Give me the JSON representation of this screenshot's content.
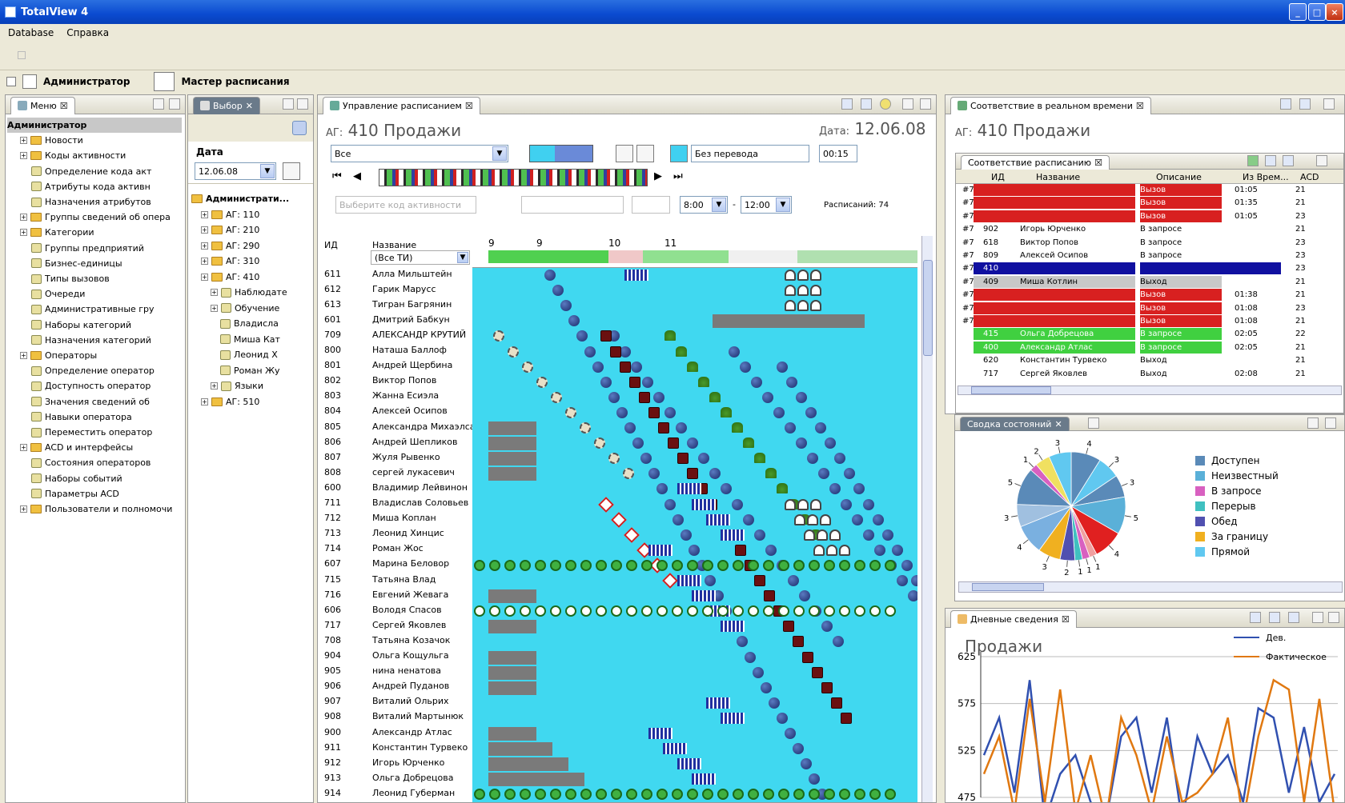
{
  "window": {
    "title": "TotalView 4",
    "btn_min": "_",
    "btn_max": "□",
    "btn_close": "×"
  },
  "menu": [
    "Database",
    "Справка"
  ],
  "perspectives": [
    "Администратор",
    "Мастер расписания"
  ],
  "menu_view": {
    "tab": "Меню",
    "items": [
      {
        "label": "Администратор",
        "level": 0,
        "selected": true
      },
      {
        "label": "Новости",
        "level": 1
      },
      {
        "label": "Коды активности",
        "level": 1
      },
      {
        "label": "Определение кода акт",
        "level": 2
      },
      {
        "label": "Атрибуты кода активн",
        "level": 2
      },
      {
        "label": "Назначения атрибутов",
        "level": 2
      },
      {
        "label": "Группы сведений об опера",
        "level": 1
      },
      {
        "label": "Категории",
        "level": 1
      },
      {
        "label": "Группы предприятий",
        "level": 2
      },
      {
        "label": "Бизнес-единицы",
        "level": 2
      },
      {
        "label": "Типы вызовов",
        "level": 2
      },
      {
        "label": "Очереди",
        "level": 2
      },
      {
        "label": "Административные гру",
        "level": 2
      },
      {
        "label": "Наборы категорий",
        "level": 2
      },
      {
        "label": "Назначения категорий",
        "level": 2
      },
      {
        "label": "Операторы",
        "level": 1
      },
      {
        "label": "Определение оператор",
        "level": 2
      },
      {
        "label": "Доступность оператор",
        "level": 2
      },
      {
        "label": "Значения сведений об",
        "level": 2
      },
      {
        "label": "Навыки оператора",
        "level": 2
      },
      {
        "label": "Переместить оператор",
        "level": 2
      },
      {
        "label": "ACD и интерфейсы",
        "level": 1
      },
      {
        "label": "Состояния операторов",
        "level": 2
      },
      {
        "label": "Наборы событий",
        "level": 2
      },
      {
        "label": "Параметры ACD",
        "level": 2
      },
      {
        "label": "Пользователи и полномочи",
        "level": 1
      }
    ]
  },
  "select_view": {
    "tab": "Выбор",
    "date_label": "Дата",
    "date_value": "12.06.08",
    "tree": [
      {
        "label": "Администрати...",
        "level": 0
      },
      {
        "label": "АГ: 110",
        "level": 1
      },
      {
        "label": "АГ: 210",
        "level": 1
      },
      {
        "label": "АГ: 290",
        "level": 1
      },
      {
        "label": "АГ: 310",
        "level": 1
      },
      {
        "label": "АГ: 410",
        "level": 1
      },
      {
        "label": "Наблюдате",
        "level": 2
      },
      {
        "label": "Обучение",
        "level": 2
      },
      {
        "label": "Владисла",
        "level": 3
      },
      {
        "label": "Миша Кат",
        "level": 3
      },
      {
        "label": "Леонид Х",
        "level": 3
      },
      {
        "label": "Роман Жу",
        "level": 3
      },
      {
        "label": "Языки",
        "level": 2
      },
      {
        "label": "АГ: 510",
        "level": 1
      }
    ]
  },
  "schedule": {
    "tab": "Управление расписанием",
    "group_prefix": "АГ:",
    "group": "410 Продажи",
    "date_label": "Дата:",
    "date": "12.06.08",
    "filter": "Все",
    "transfer": "Без перевода",
    "duration": "00:15",
    "from": "8:00",
    "to": "12:00",
    "count_label": "Расписаний: 74",
    "hint": "Выберите код активности",
    "col_id": "ИД",
    "col_name": "Название",
    "col_filter": "(Все ТИ)",
    "hours": [
      "9",
      "9",
      "10",
      "11"
    ],
    "rows": [
      {
        "id": "611",
        "name": "Алла Мильштейн"
      },
      {
        "id": "612",
        "name": "Гарик Марусс"
      },
      {
        "id": "613",
        "name": "Тигран Багрянин"
      },
      {
        "id": "601",
        "name": "Дмитрий Бабкун"
      },
      {
        "id": "709",
        "name": "АЛЕКСАНДР КРУТИЙ"
      },
      {
        "id": "800",
        "name": "Наташа Баллоф"
      },
      {
        "id": "801",
        "name": "Андрей Щербина"
      },
      {
        "id": "802",
        "name": "Виктор Попов"
      },
      {
        "id": "803",
        "name": "Жанна Есиэла"
      },
      {
        "id": "804",
        "name": "Алексей Осипов"
      },
      {
        "id": "805",
        "name": "Александра Михаэлса"
      },
      {
        "id": "806",
        "name": "Андрей Шепликов"
      },
      {
        "id": "807",
        "name": "Жуля Рывенко"
      },
      {
        "id": "808",
        "name": "сергей лукасевич"
      },
      {
        "id": "600",
        "name": "Владимир Лейвинон"
      },
      {
        "id": "711",
        "name": "Владислав Соловьев"
      },
      {
        "id": "712",
        "name": "Миша Коплан"
      },
      {
        "id": "713",
        "name": "Леонид Хинцис"
      },
      {
        "id": "714",
        "name": "Роман Жос"
      },
      {
        "id": "607",
        "name": "Марина Беловор"
      },
      {
        "id": "715",
        "name": "Татьяна Влад"
      },
      {
        "id": "716",
        "name": "Евгений Жевага"
      },
      {
        "id": "606",
        "name": "Володя Спасов"
      },
      {
        "id": "717",
        "name": "Сергей Яковлев"
      },
      {
        "id": "708",
        "name": "Татьяна Козачок"
      },
      {
        "id": "904",
        "name": "Ольга Кощульга"
      },
      {
        "id": "905",
        "name": "нина ненатова"
      },
      {
        "id": "906",
        "name": "Андрей Пуданов"
      },
      {
        "id": "907",
        "name": "Виталий Ольрих"
      },
      {
        "id": "908",
        "name": "Виталий Мартынюк"
      },
      {
        "id": "900",
        "name": "Александр Атлас"
      },
      {
        "id": "911",
        "name": "Константин Турвеко"
      },
      {
        "id": "912",
        "name": "Игорь Юрченко"
      },
      {
        "id": "913",
        "name": "Ольга Добрецова"
      },
      {
        "id": "914",
        "name": "Леонид Губерман"
      }
    ]
  },
  "realtime": {
    "tab": "Соответствие в реальном времени",
    "group_prefix": "АГ:",
    "group": "410 Продажи",
    "subtab": "Соответствие расписанию",
    "headers": [
      "ИД",
      "Название",
      "Описание",
      "Из Врем...",
      "ACD"
    ],
    "rows": [
      {
        "flag": "#7",
        "id": "",
        "name": "",
        "desc": "Вызов",
        "time": "01:05",
        "acd": "21",
        "color": "#d82020"
      },
      {
        "flag": "#7",
        "id": "",
        "name": "",
        "desc": "Вызов",
        "time": "01:35",
        "acd": "21",
        "color": "#d82020"
      },
      {
        "flag": "#7",
        "id": "",
        "name": "",
        "desc": "Вызов",
        "time": "01:05",
        "acd": "23",
        "color": "#d82020"
      },
      {
        "flag": "#7",
        "id": "902",
        "name": "Игорь Юрченко",
        "desc": "В запросе",
        "time": "",
        "acd": "21",
        "color": ""
      },
      {
        "flag": "#7",
        "id": "618",
        "name": "Виктор Попов",
        "desc": "В запросе",
        "time": "",
        "acd": "23",
        "color": ""
      },
      {
        "flag": "#7",
        "id": "809",
        "name": "Алексей Осипов",
        "desc": "В запросе",
        "time": "",
        "acd": "23",
        "color": ""
      },
      {
        "flag": "#7",
        "id": "410",
        "name": "",
        "desc": "",
        "time": "",
        "acd": "23",
        "color": "#1010a0"
      },
      {
        "flag": "#7",
        "id": "409",
        "name": "Миша Котлин",
        "desc": "Выход",
        "time": "",
        "acd": "21",
        "color": "#c8c8c8"
      },
      {
        "flag": "#7",
        "id": "",
        "name": "",
        "desc": "Вызов",
        "time": "01:38",
        "acd": "21",
        "color": "#d82020"
      },
      {
        "flag": "#7",
        "id": "",
        "name": "",
        "desc": "Вызов",
        "time": "01:08",
        "acd": "23",
        "color": "#d82020"
      },
      {
        "flag": "#7",
        "id": "",
        "name": "",
        "desc": "Вызов",
        "time": "01:08",
        "acd": "21",
        "color": "#d82020"
      },
      {
        "flag": "",
        "id": "415",
        "name": "Ольга Добрецова",
        "desc": "В запросе",
        "time": "02:05",
        "acd": "22",
        "color": "#40d040"
      },
      {
        "flag": "",
        "id": "400",
        "name": "Александр Атлас",
        "desc": "В запросе",
        "time": "02:05",
        "acd": "21",
        "color": "#40d040"
      },
      {
        "flag": "",
        "id": "620",
        "name": "Константин Турвеко",
        "desc": "Выход",
        "time": "",
        "acd": "21",
        "color": ""
      },
      {
        "flag": "",
        "id": "717",
        "name": "Сергей Яковлев",
        "desc": "Выход",
        "time": "02:08",
        "acd": "21",
        "color": ""
      }
    ]
  },
  "pie_view": {
    "tab": "Сводка состояний",
    "legend": [
      {
        "label": "Доступен",
        "color": "#5a8ab8"
      },
      {
        "label": "Неизвестный",
        "color": "#5ab0d8"
      },
      {
        "label": "В запросе",
        "color": "#d860c0"
      },
      {
        "label": "Перерыв",
        "color": "#40c0c0"
      },
      {
        "label": "Обед",
        "color": "#5050b0"
      },
      {
        "label": "За границу",
        "color": "#f0b020"
      },
      {
        "label": "Прямой",
        "color": "#60c8f0"
      }
    ],
    "slices": [
      {
        "value": 4,
        "color": "#5a8ab8"
      },
      {
        "value": 3,
        "color": "#60c8f0"
      },
      {
        "value": 3,
        "color": "#5a8ab8"
      },
      {
        "value": 5,
        "color": "#5ab0d8"
      },
      {
        "value": 4,
        "color": "#e02020"
      },
      {
        "value": 1,
        "color": "#f0a0a0"
      },
      {
        "value": 1,
        "color": "#d860c0"
      },
      {
        "value": 1,
        "color": "#40c0c0"
      },
      {
        "value": 2,
        "color": "#5050b0"
      },
      {
        "value": 3,
        "color": "#f0b020"
      },
      {
        "value": 4,
        "color": "#7ab0e0"
      },
      {
        "value": 3,
        "color": "#a0c0e0"
      },
      {
        "value": 5,
        "color": "#5a8ab8"
      },
      {
        "value": 1,
        "color": "#d860c0"
      },
      {
        "value": 2,
        "color": "#f0e060"
      },
      {
        "value": 3,
        "color": "#60c8f0"
      }
    ],
    "slice_labels": [
      "4",
      "3",
      "3",
      "5",
      "4",
      "1",
      "1",
      "1",
      "2",
      "3",
      "4",
      "3",
      "5",
      "1",
      "2",
      "3"
    ]
  },
  "chart_data": {
    "type": "line",
    "title": "Продажи",
    "ylim": [
      475,
      625
    ],
    "yticks": [
      475,
      525,
      575,
      625
    ],
    "series": [
      {
        "name": "Дев.",
        "color": "#3050b0",
        "values": [
          520,
          560,
          480,
          600,
          450,
          500,
          520,
          470,
          450,
          540,
          560,
          480,
          560,
          450,
          540,
          500,
          520,
          470,
          570,
          560,
          480,
          550,
          470,
          500
        ]
      },
      {
        "name": "Фактическое",
        "color": "#e07810",
        "values": [
          500,
          540,
          460,
          580,
          470,
          590,
          460,
          520,
          450,
          560,
          520,
          460,
          540,
          470,
          480,
          500,
          560,
          450,
          540,
          600,
          590,
          470,
          580,
          460
        ]
      }
    ]
  },
  "daily_view": {
    "tab": "Дневные сведения"
  }
}
